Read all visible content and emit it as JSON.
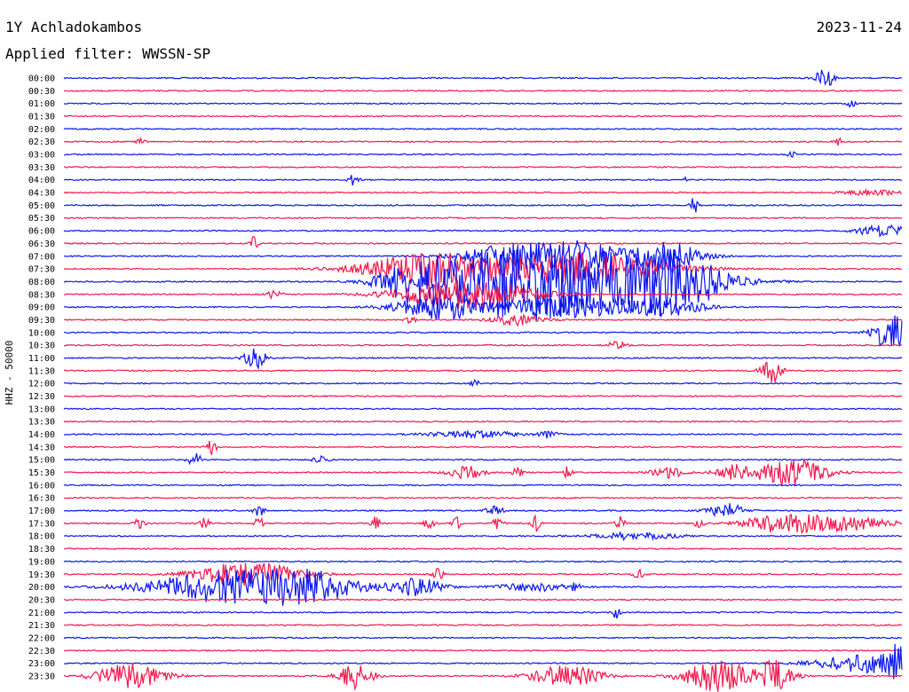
{
  "header": {
    "station": "1Y Achladokambos",
    "date": "2023-11-24",
    "filter": "Applied filter: WWSSN-SP"
  },
  "axis": {
    "ylabel": "HHZ - 50000"
  },
  "colors": {
    "blue": "#0a16f0",
    "red": "#f2184c",
    "background": "#ffffff",
    "text": "#000000"
  },
  "chart_data": {
    "type": "seismogram-helicorder",
    "ylabel": "HHZ - 50000",
    "trace_colors_alternating": [
      "#0a16f0",
      "#f2184c"
    ],
    "x_range_minutes": [
      0,
      30
    ],
    "rows": [
      {
        "label": "00:00",
        "events": [
          {
            "t": 0.908,
            "amp": 12,
            "dur": 0.01
          }
        ]
      },
      {
        "label": "00:30",
        "events": []
      },
      {
        "label": "01:00",
        "events": [
          {
            "t": 0.94,
            "amp": 4,
            "dur": 0.005
          }
        ]
      },
      {
        "label": "01:30",
        "events": []
      },
      {
        "label": "02:00",
        "events": []
      },
      {
        "label": "02:30",
        "events": [
          {
            "t": 0.092,
            "amp": 4,
            "dur": 0.005
          },
          {
            "t": 0.924,
            "amp": 5,
            "dur": 0.005
          }
        ]
      },
      {
        "label": "03:00",
        "events": [
          {
            "t": 0.868,
            "amp": 3,
            "dur": 0.005
          }
        ]
      },
      {
        "label": "03:30",
        "events": []
      },
      {
        "label": "04:00",
        "events": [
          {
            "t": 0.346,
            "amp": 6,
            "dur": 0.006
          },
          {
            "t": 0.742,
            "amp": 3,
            "dur": 0.005
          }
        ]
      },
      {
        "label": "04:30",
        "events": [
          {
            "t": 0.963,
            "amp": 3,
            "dur": 0.03
          }
        ]
      },
      {
        "label": "05:00",
        "events": [
          {
            "t": 0.752,
            "amp": 10,
            "dur": 0.005
          }
        ]
      },
      {
        "label": "05:30",
        "events": []
      },
      {
        "label": "06:00",
        "events": [
          {
            "t": 0.978,
            "amp": 7,
            "dur": 0.03
          }
        ]
      },
      {
        "label": "06:30",
        "events": [
          {
            "t": 0.228,
            "amp": 12,
            "dur": 0.004
          }
        ]
      },
      {
        "label": "07:00",
        "events": [
          {
            "t": 0.54,
            "amp": 15,
            "dur": 0.06
          },
          {
            "t": 0.62,
            "amp": 14,
            "dur": 0.05
          },
          {
            "t": 0.72,
            "amp": 16,
            "dur": 0.04
          }
        ]
      },
      {
        "label": "07:30",
        "events": [
          {
            "t": 0.44,
            "amp": 18,
            "dur": 0.08
          },
          {
            "t": 0.62,
            "amp": 18,
            "dur": 0.1
          }
        ]
      },
      {
        "label": "08:00",
        "events": [
          {
            "t": 0.42,
            "amp": 22,
            "dur": 0.04
          },
          {
            "t": 0.52,
            "amp": 28,
            "dur": 0.08
          },
          {
            "t": 0.63,
            "amp": 30,
            "dur": 0.12
          },
          {
            "t": 0.73,
            "amp": 24,
            "dur": 0.05
          }
        ]
      },
      {
        "label": "08:30",
        "events": [
          {
            "t": 0.25,
            "amp": 4,
            "dur": 0.01
          },
          {
            "t": 0.48,
            "amp": 16,
            "dur": 0.08
          }
        ]
      },
      {
        "label": "09:00",
        "events": [
          {
            "t": 0.45,
            "amp": 14,
            "dur": 0.05
          },
          {
            "t": 0.6,
            "amp": 12,
            "dur": 0.08
          },
          {
            "t": 0.72,
            "amp": 10,
            "dur": 0.04
          }
        ]
      },
      {
        "label": "09:30",
        "events": [
          {
            "t": 0.414,
            "amp": 4,
            "dur": 0.006
          },
          {
            "t": 0.54,
            "amp": 6,
            "dur": 0.03
          }
        ]
      },
      {
        "label": "10:00",
        "events": [
          {
            "t": 0.987,
            "amp": 22,
            "dur": 0.02
          }
        ]
      },
      {
        "label": "10:30",
        "events": [
          {
            "t": 0.66,
            "amp": 5,
            "dur": 0.01
          }
        ]
      },
      {
        "label": "11:00",
        "events": [
          {
            "t": 0.228,
            "amp": 12,
            "dur": 0.012
          }
        ]
      },
      {
        "label": "11:30",
        "events": [
          {
            "t": 0.845,
            "amp": 14,
            "dur": 0.012
          }
        ]
      },
      {
        "label": "12:00",
        "events": [
          {
            "t": 0.49,
            "amp": 4,
            "dur": 0.006
          }
        ]
      },
      {
        "label": "12:30",
        "events": []
      },
      {
        "label": "13:00",
        "events": []
      },
      {
        "label": "13:30",
        "events": []
      },
      {
        "label": "14:00",
        "events": [
          {
            "t": 0.49,
            "amp": 4,
            "dur": 0.05
          },
          {
            "t": 0.578,
            "amp": 4,
            "dur": 0.01
          }
        ]
      },
      {
        "label": "14:30",
        "events": [
          {
            "t": 0.176,
            "amp": 8,
            "dur": 0.006
          }
        ]
      },
      {
        "label": "15:00",
        "events": [
          {
            "t": 0.156,
            "amp": 8,
            "dur": 0.008
          },
          {
            "t": 0.306,
            "amp": 7,
            "dur": 0.008
          }
        ]
      },
      {
        "label": "15:30",
        "events": [
          {
            "t": 0.48,
            "amp": 8,
            "dur": 0.02
          },
          {
            "t": 0.54,
            "amp": 8,
            "dur": 0.006
          },
          {
            "t": 0.6,
            "amp": 7,
            "dur": 0.006
          },
          {
            "t": 0.72,
            "amp": 6,
            "dur": 0.02
          },
          {
            "t": 0.8,
            "amp": 9,
            "dur": 0.02
          },
          {
            "t": 0.868,
            "amp": 16,
            "dur": 0.04
          }
        ]
      },
      {
        "label": "16:00",
        "events": []
      },
      {
        "label": "16:30",
        "events": []
      },
      {
        "label": "17:00",
        "events": [
          {
            "t": 0.233,
            "amp": 7,
            "dur": 0.006
          },
          {
            "t": 0.514,
            "amp": 5,
            "dur": 0.01
          },
          {
            "t": 0.79,
            "amp": 9,
            "dur": 0.02
          }
        ]
      },
      {
        "label": "17:30",
        "events": [
          {
            "t": 0.09,
            "amp": 8,
            "dur": 0.006
          },
          {
            "t": 0.168,
            "amp": 9,
            "dur": 0.005
          },
          {
            "t": 0.232,
            "amp": 9,
            "dur": 0.005
          },
          {
            "t": 0.372,
            "amp": 8,
            "dur": 0.005
          },
          {
            "t": 0.436,
            "amp": 10,
            "dur": 0.005
          },
          {
            "t": 0.468,
            "amp": 8,
            "dur": 0.005
          },
          {
            "t": 0.518,
            "amp": 8,
            "dur": 0.006
          },
          {
            "t": 0.563,
            "amp": 10,
            "dur": 0.005
          },
          {
            "t": 0.664,
            "amp": 9,
            "dur": 0.005
          },
          {
            "t": 0.758,
            "amp": 6,
            "dur": 0.005
          },
          {
            "t": 0.85,
            "amp": 8,
            "dur": 0.04
          },
          {
            "t": 0.92,
            "amp": 9,
            "dur": 0.06
          }
        ]
      },
      {
        "label": "18:00",
        "events": [
          {
            "t": 0.68,
            "amp": 4,
            "dur": 0.05
          }
        ]
      },
      {
        "label": "18:30",
        "events": []
      },
      {
        "label": "19:00",
        "events": []
      },
      {
        "label": "19:30",
        "events": [
          {
            "t": 0.22,
            "amp": 14,
            "dur": 0.06
          },
          {
            "t": 0.446,
            "amp": 8,
            "dur": 0.006
          },
          {
            "t": 0.686,
            "amp": 5,
            "dur": 0.006
          }
        ]
      },
      {
        "label": "20:00",
        "events": [
          {
            "t": 0.21,
            "amp": 20,
            "dur": 0.1
          },
          {
            "t": 0.3,
            "amp": 10,
            "dur": 0.05
          },
          {
            "t": 0.42,
            "amp": 10,
            "dur": 0.03
          },
          {
            "t": 0.56,
            "amp": 5,
            "dur": 0.04
          },
          {
            "t": 0.61,
            "amp": 5,
            "dur": 0.005
          }
        ]
      },
      {
        "label": "20:30",
        "events": []
      },
      {
        "label": "21:00",
        "events": [
          {
            "t": 0.658,
            "amp": 7,
            "dur": 0.006
          }
        ]
      },
      {
        "label": "21:30",
        "events": []
      },
      {
        "label": "22:00",
        "events": []
      },
      {
        "label": "22:30",
        "events": []
      },
      {
        "label": "23:00",
        "events": [
          {
            "t": 0.96,
            "amp": 10,
            "dur": 0.06
          },
          {
            "t": 0.995,
            "amp": 14,
            "dur": 0.02
          }
        ]
      },
      {
        "label": "23:30",
        "events": [
          {
            "t": 0.08,
            "amp": 14,
            "dur": 0.04
          },
          {
            "t": 0.348,
            "amp": 14,
            "dur": 0.02
          },
          {
            "t": 0.6,
            "amp": 12,
            "dur": 0.04
          },
          {
            "t": 0.78,
            "amp": 18,
            "dur": 0.04
          },
          {
            "t": 0.85,
            "amp": 18,
            "dur": 0.02
          }
        ]
      }
    ]
  }
}
